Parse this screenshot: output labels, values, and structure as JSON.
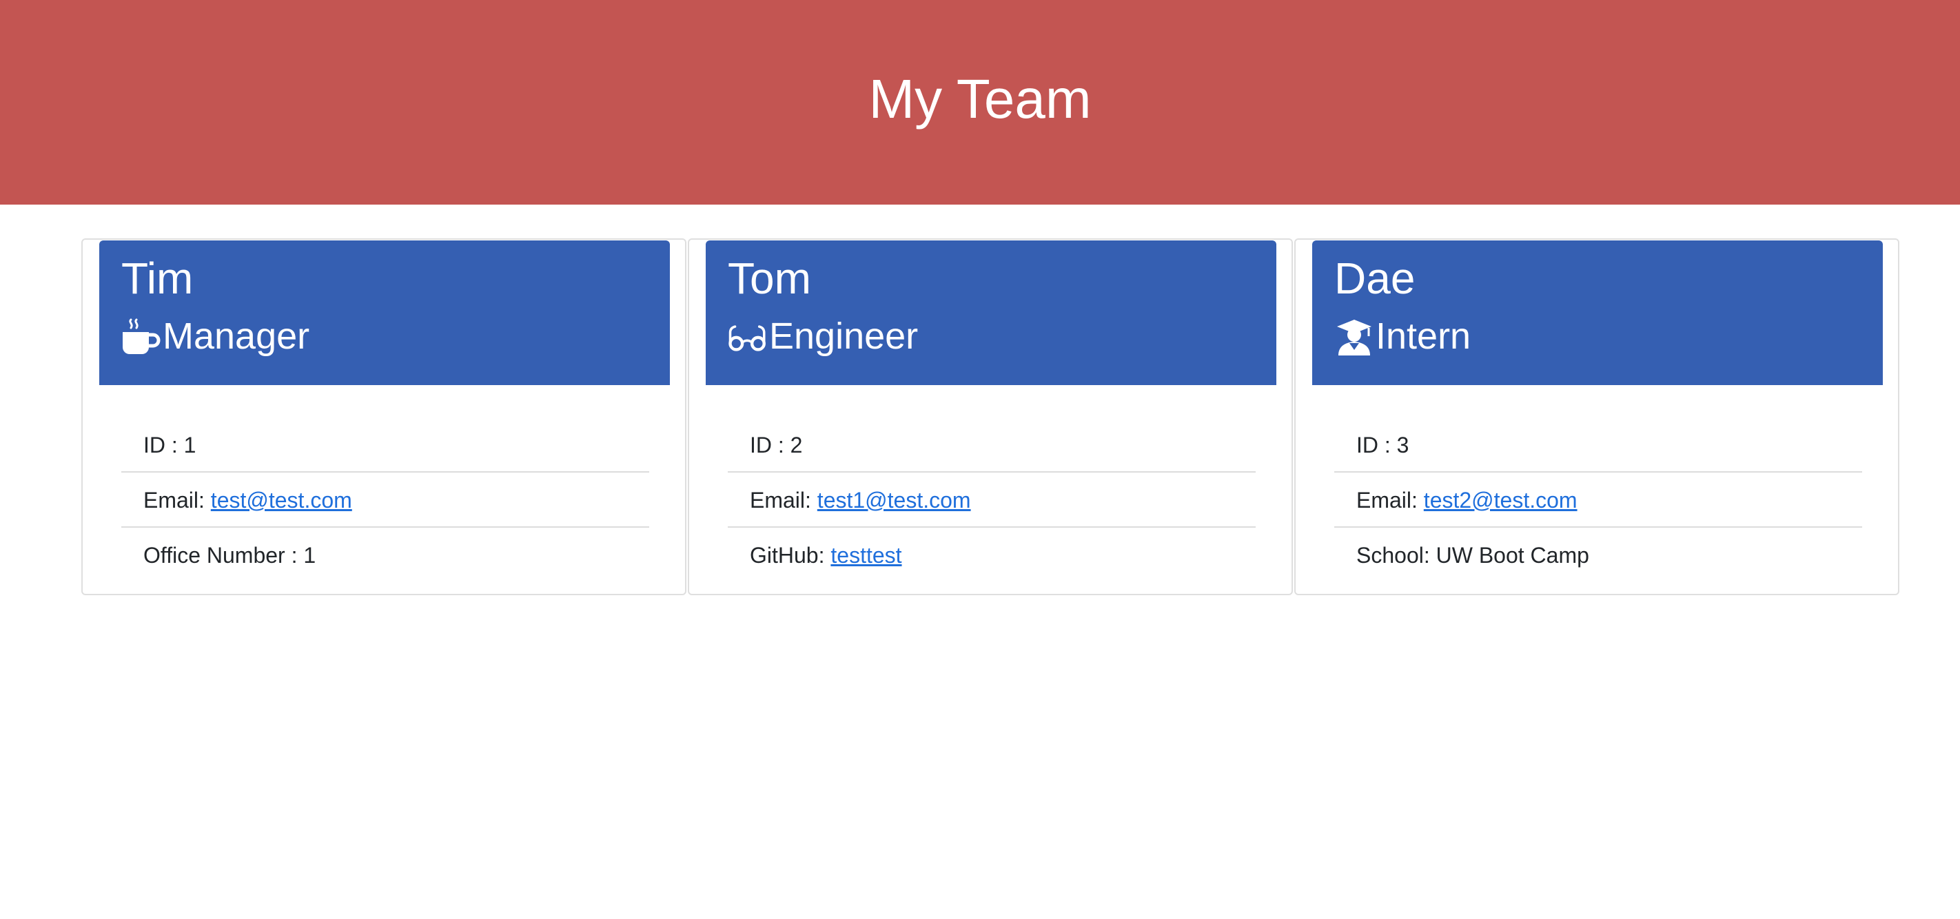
{
  "header": {
    "title": "My Team"
  },
  "cards": [
    {
      "name": "Tim",
      "role": "Manager",
      "role_icon": "mug-icon",
      "id_label": "ID : 1",
      "email_label": "Email: ",
      "email": "test@test.com",
      "extra_label": "Office Number : 1",
      "extra_link": ""
    },
    {
      "name": "Tom",
      "role": "Engineer",
      "role_icon": "glasses-icon",
      "id_label": "ID : 2",
      "email_label": "Email: ",
      "email": "test1@test.com",
      "extra_label": "GitHub: ",
      "extra_link": "testtest"
    },
    {
      "name": "Dae",
      "role": "Intern",
      "role_icon": "graduate-icon",
      "id_label": "ID : 3",
      "email_label": "Email: ",
      "email": "test2@test.com",
      "extra_label": "School: UW Boot Camp",
      "extra_link": ""
    }
  ],
  "colors": {
    "header_bg": "#c35552",
    "card_header_bg": "#355fb2",
    "link": "#1f6fdc"
  }
}
